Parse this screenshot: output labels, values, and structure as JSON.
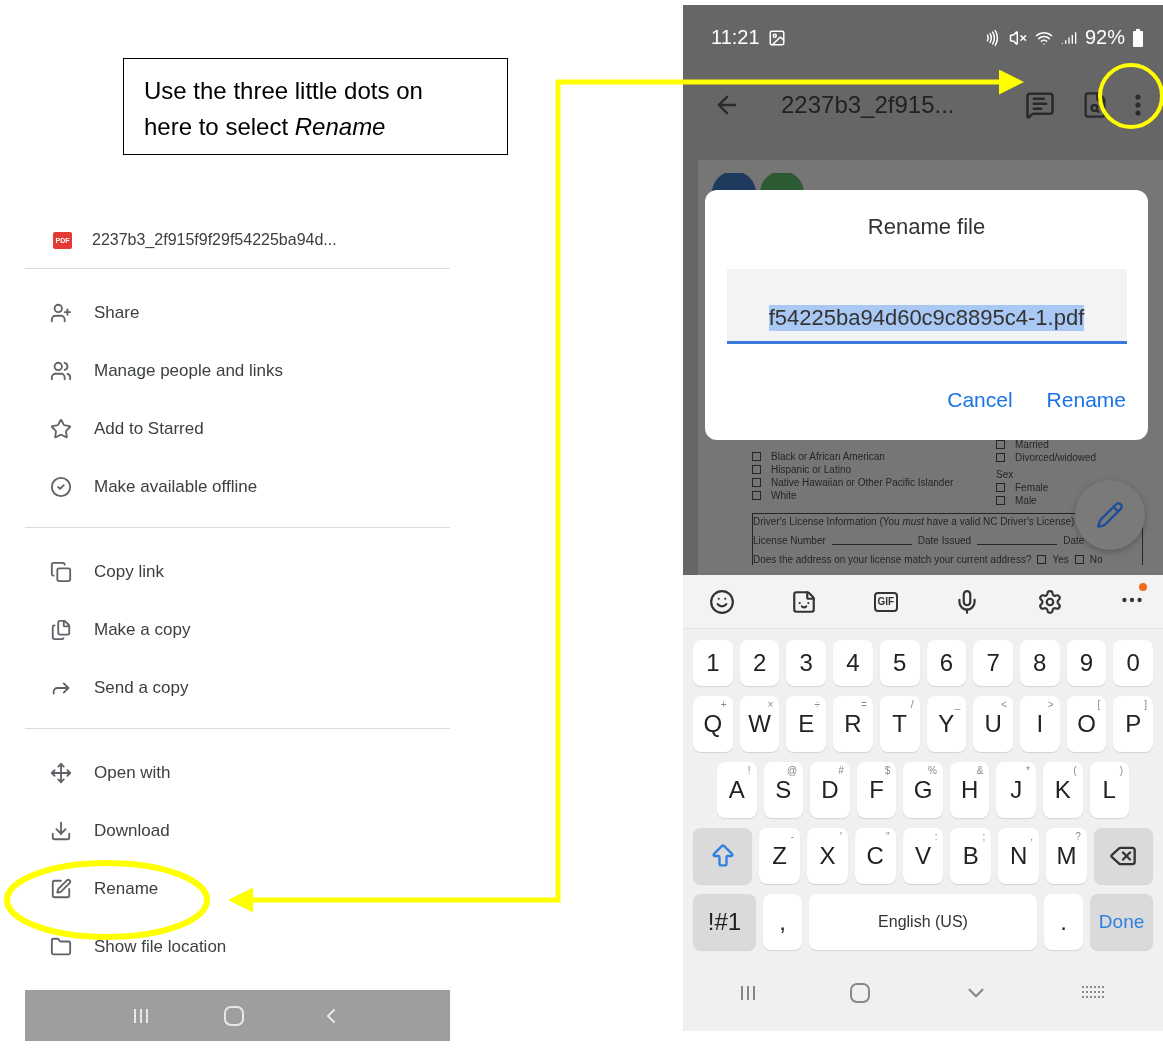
{
  "callout": {
    "text": "Use the three little dots on here to select *Rename*"
  },
  "file_menu": {
    "file": {
      "badge": "PDF",
      "name": "2237b3_2f915f9f29f54225ba94d..."
    },
    "groups": [
      [
        {
          "kind": "share",
          "label": "Share"
        },
        {
          "kind": "people",
          "label": "Manage people and links"
        },
        {
          "kind": "star",
          "label": "Add to Starred"
        },
        {
          "kind": "offline",
          "label": "Make available offline"
        }
      ],
      [
        {
          "kind": "link",
          "label": "Copy link"
        },
        {
          "kind": "copy",
          "label": "Make a copy"
        },
        {
          "kind": "send",
          "label": "Send a copy"
        }
      ],
      [
        {
          "kind": "open",
          "label": "Open with"
        },
        {
          "kind": "download",
          "label": "Download"
        },
        {
          "kind": "rename",
          "label": "Rename"
        },
        {
          "kind": "folder",
          "label": "Show file location"
        }
      ]
    ],
    "nav_bar": [
      {
        "kind": "recent"
      },
      {
        "kind": "home"
      },
      {
        "kind": "back"
      }
    ]
  },
  "phone": {
    "status_bar": {
      "time": "11:21",
      "battery": "92%"
    },
    "toolbar": {
      "title": "2237b3_2f915..."
    },
    "document": {
      "race_options": [
        {
          "label": "Black or African American",
          "checked": false
        },
        {
          "label": "Hispanic or Latino",
          "checked": false
        },
        {
          "label": "Native Hawaiian or Other Pacific Islander",
          "checked": false
        },
        {
          "label": "White",
          "checked": false
        }
      ],
      "marital_options": [
        {
          "label": "Married",
          "checked": false
        },
        {
          "label": "Divorced/widowed",
          "checked": false
        }
      ],
      "sex": {
        "label": "Sex",
        "options": [
          {
            "label": "Female",
            "checked": false
          },
          {
            "label": "Male",
            "checked": false
          }
        ]
      },
      "license": {
        "heading": "Driver's License Information (You *must* have a valid NC Driver's License)",
        "fields": [
          "License Number",
          "Date Issued",
          "Date"
        ],
        "question": "Does the address on your license match your current address?",
        "answers": [
          {
            "label": "Yes",
            "checked": false
          },
          {
            "label": "No",
            "checked": false
          }
        ]
      }
    },
    "dialog": {
      "title": "Rename file",
      "value": "f54225ba94d60c9c8895c4-1.pdf",
      "value_selected": true,
      "buttons": [
        "Cancel",
        "Rename"
      ]
    },
    "keyboard": {
      "tools": [
        {
          "kind": "emoji"
        },
        {
          "kind": "sticker"
        },
        {
          "kind": "gif",
          "label": "GIF"
        },
        {
          "kind": "mic"
        },
        {
          "kind": "settings"
        },
        {
          "kind": "more"
        }
      ],
      "rows": [
        [
          {
            "kind": "char",
            "label": "1"
          },
          {
            "kind": "char",
            "label": "2"
          },
          {
            "kind": "char",
            "label": "3"
          },
          {
            "kind": "char",
            "label": "4"
          },
          {
            "kind": "char",
            "label": "5"
          },
          {
            "kind": "char",
            "label": "6"
          },
          {
            "kind": "char",
            "label": "7"
          },
          {
            "kind": "char",
            "label": "8"
          },
          {
            "kind": "char",
            "label": "9"
          },
          {
            "kind": "char",
            "label": "0"
          }
        ],
        [
          {
            "kind": "char",
            "label": "Q",
            "hint": "+"
          },
          {
            "kind": "char",
            "label": "W",
            "hint": "×"
          },
          {
            "kind": "char",
            "label": "E",
            "hint": "÷"
          },
          {
            "kind": "char",
            "label": "R",
            "hint": "="
          },
          {
            "kind": "char",
            "label": "T",
            "hint": "/"
          },
          {
            "kind": "char",
            "label": "Y",
            "hint": "_"
          },
          {
            "kind": "char",
            "label": "U",
            "hint": "<"
          },
          {
            "kind": "char",
            "label": "I",
            "hint": ">"
          },
          {
            "kind": "char",
            "label": "O",
            "hint": "["
          },
          {
            "kind": "char",
            "label": "P",
            "hint": "]"
          }
        ],
        [
          {
            "kind": "char",
            "label": "A",
            "hint": "!"
          },
          {
            "kind": "char",
            "label": "S",
            "hint": "@"
          },
          {
            "kind": "char",
            "label": "D",
            "hint": "#"
          },
          {
            "kind": "char",
            "label": "F",
            "hint": "$"
          },
          {
            "kind": "char",
            "label": "G",
            "hint": "%"
          },
          {
            "kind": "char",
            "label": "H",
            "hint": "&"
          },
          {
            "kind": "char",
            "label": "J",
            "hint": "*"
          },
          {
            "kind": "char",
            "label": "K",
            "hint": "("
          },
          {
            "kind": "char",
            "label": "L",
            "hint": ")"
          }
        ],
        [
          {
            "kind": "shift"
          },
          {
            "kind": "char",
            "label": "Z",
            "hint": "-"
          },
          {
            "kind": "char",
            "label": "X",
            "hint": "'"
          },
          {
            "kind": "char",
            "label": "C",
            "hint": "\""
          },
          {
            "kind": "char",
            "label": "V",
            "hint": ":"
          },
          {
            "kind": "char",
            "label": "B",
            "hint": ";"
          },
          {
            "kind": "char",
            "label": "N",
            "hint": ","
          },
          {
            "kind": "char",
            "label": "M",
            "hint": "?"
          },
          {
            "kind": "backspace"
          }
        ]
      ],
      "bottom_row": [
        {
          "kind": "symbols",
          "label": "!#1"
        },
        {
          "kind": "char",
          "label": ","
        },
        {
          "kind": "space",
          "label": "English (US)"
        },
        {
          "kind": "char",
          "label": "."
        },
        {
          "kind": "done",
          "label": "Done"
        }
      ]
    },
    "nav_bar": [
      {
        "kind": "recent"
      },
      {
        "kind": "home"
      },
      {
        "kind": "hide"
      },
      {
        "kind": "keyboard"
      }
    ]
  }
}
